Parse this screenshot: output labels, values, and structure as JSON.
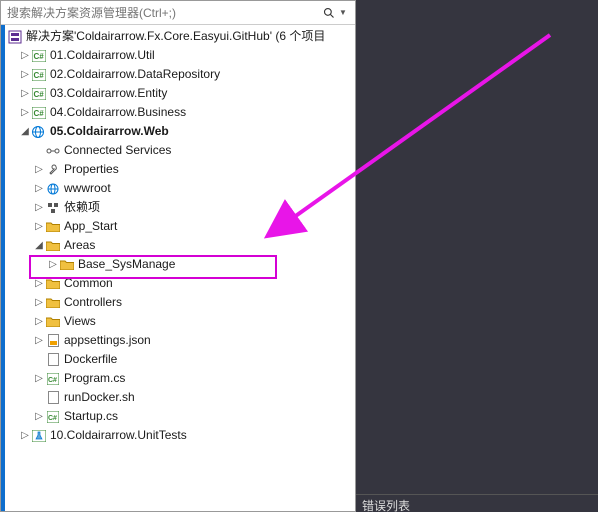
{
  "search": {
    "placeholder": "搜索解决方案资源管理器(Ctrl+;)"
  },
  "solution": {
    "label": "解决方案'Coldairarrow.Fx.Core.Easyui.GitHub' (6 个项目"
  },
  "right": {
    "footer": "错误列表"
  },
  "projects": {
    "p1": "01.Coldairarrow.Util",
    "p2": "02.Coldairarrow.DataRepository",
    "p3": "03.Coldairarrow.Entity",
    "p4": "04.Coldairarrow.Business",
    "p5": "05.Coldairarrow.Web",
    "p10": "10.Coldairarrow.UnitTests"
  },
  "web": {
    "connected": "Connected Services",
    "properties": "Properties",
    "wwwroot": "wwwroot",
    "deps": "依赖项",
    "appstart": "App_Start",
    "areas": "Areas",
    "base": "Base_SysManage",
    "common": "Common",
    "controllers": "Controllers",
    "views": "Views",
    "appsettings": "appsettings.json",
    "dockerfile": "Dockerfile",
    "program": "Program.cs",
    "rundocker": "runDocker.sh",
    "startup": "Startup.cs"
  }
}
